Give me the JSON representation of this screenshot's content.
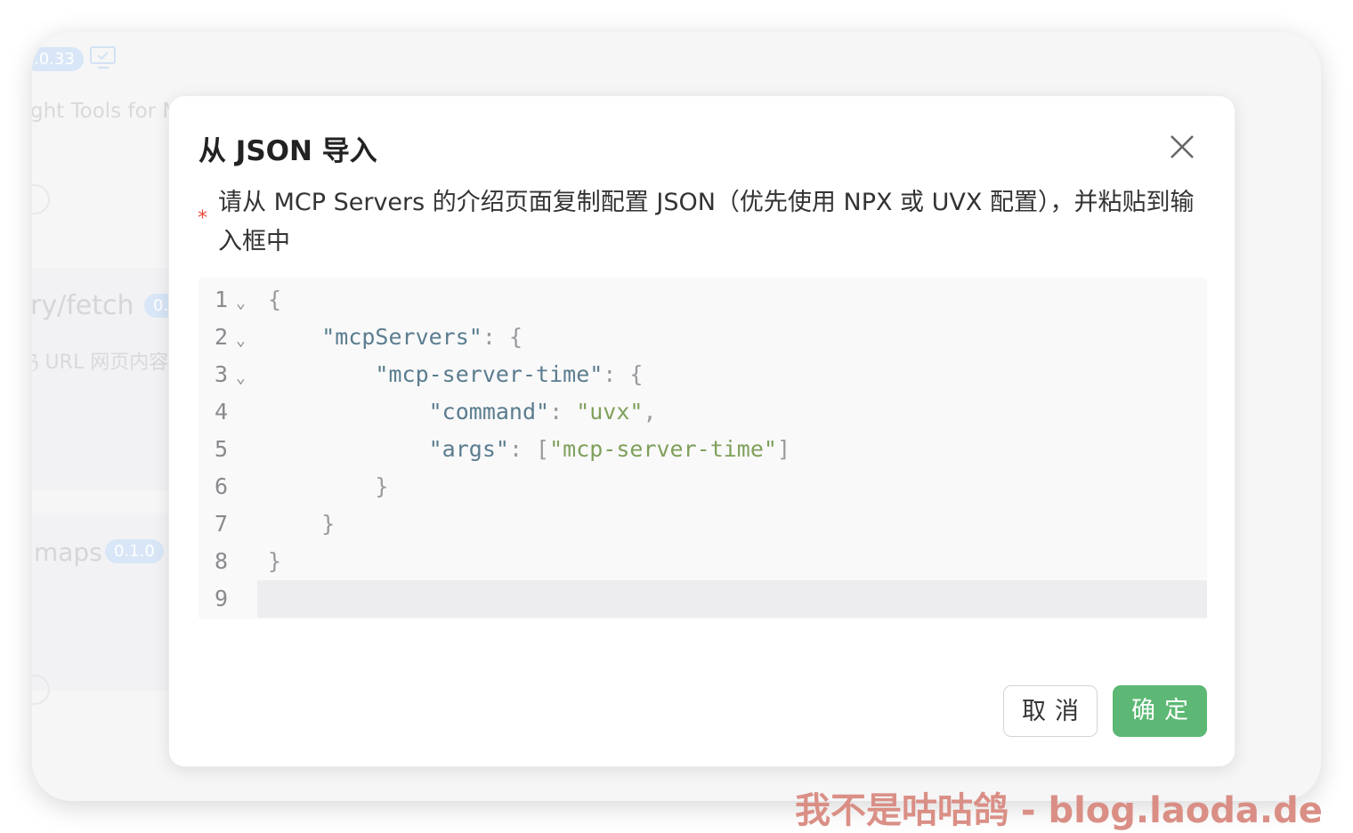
{
  "background": {
    "version_badge": ".0.33",
    "subtitle_fragment": "ght Tools for M",
    "server1_name": "ry/fetch",
    "server1_badge": "0.",
    "server1_desc": "ℨ URL 网页内容",
    "server2_name": "maps",
    "server2_badge": "0.1.0"
  },
  "modal": {
    "title": "从 JSON 导入",
    "required_mark": "*",
    "description": "请从 MCP Servers 的介绍页面复制配置 JSON（优先使用 NPX 或 UVX 配置），并粘贴到输入框中",
    "cancel_label": "取消",
    "ok_label": "确定"
  },
  "editor": {
    "lines": [
      {
        "n": "1",
        "fold": true
      },
      {
        "n": "2",
        "fold": true
      },
      {
        "n": "3",
        "fold": true
      },
      {
        "n": "4",
        "fold": false
      },
      {
        "n": "5",
        "fold": false
      },
      {
        "n": "6",
        "fold": false
      },
      {
        "n": "7",
        "fold": false
      },
      {
        "n": "8",
        "fold": false
      },
      {
        "n": "9",
        "fold": false
      }
    ],
    "code": {
      "l1": "{",
      "l2_key": "\"mcpServers\"",
      "l2_rest": ": {",
      "l3_key": "\"mcp-server-time\"",
      "l3_rest": ": {",
      "l4_key": "\"command\"",
      "l4_sep": ": ",
      "l4_val": "\"uvx\"",
      "l4_end": ",",
      "l5_key": "\"args\"",
      "l5_sep": ": [",
      "l5_val": "\"mcp-server-time\"",
      "l5_end": "]",
      "l6": "}",
      "l7": "}",
      "l8": "}"
    }
  },
  "colors": {
    "accent_green": "#5cb874",
    "required_red": "#e74c3c",
    "json_key": "#5b7d8f",
    "json_string": "#7fa05a"
  },
  "watermark": "我不是咕咕鸽 - blog.laoda.de"
}
